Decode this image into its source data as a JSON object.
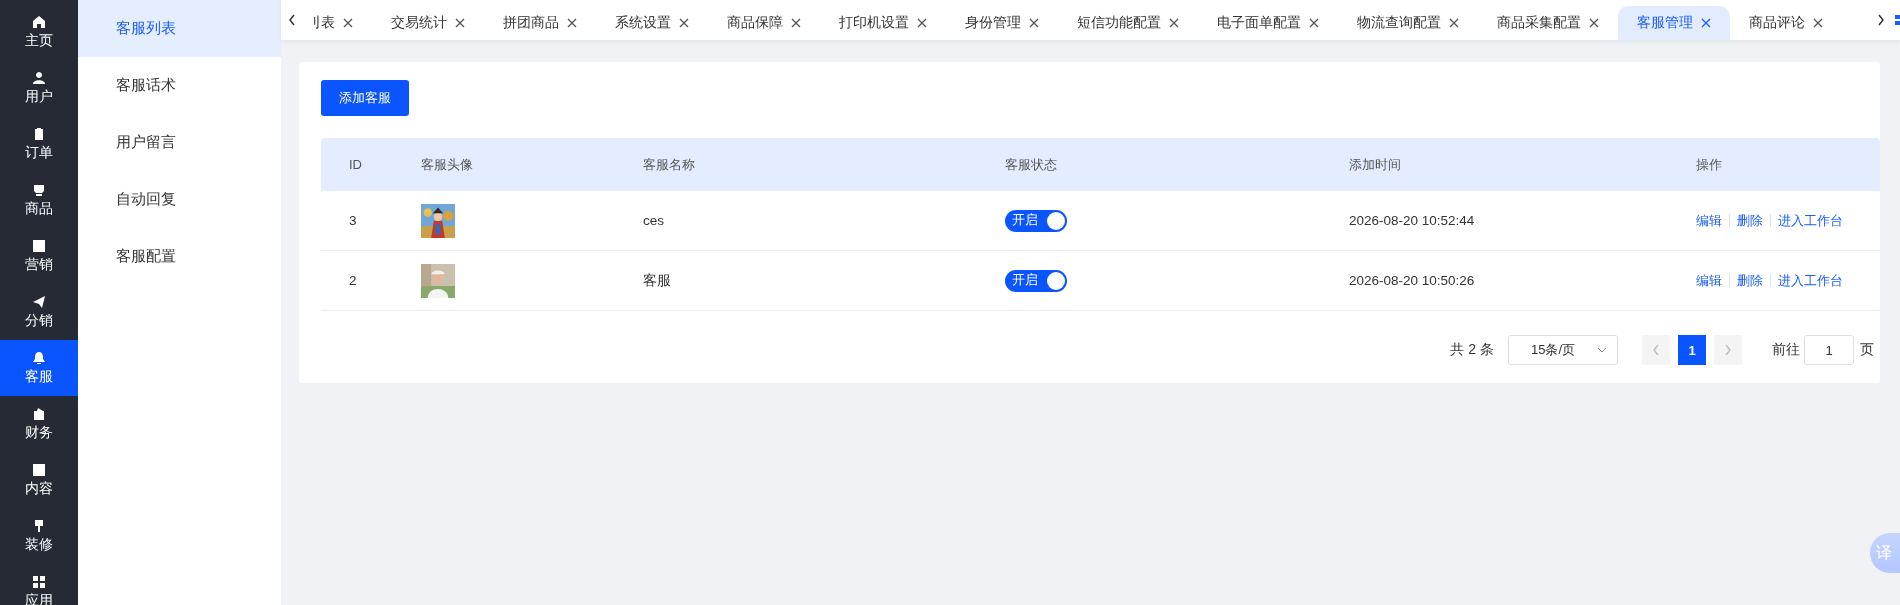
{
  "nav": [
    {
      "label": "主页",
      "selected": false
    },
    {
      "label": "用户",
      "selected": false
    },
    {
      "label": "订单",
      "selected": false
    },
    {
      "label": "商品",
      "selected": false
    },
    {
      "label": "营销",
      "selected": false
    },
    {
      "label": "分销",
      "selected": false
    },
    {
      "label": "客服",
      "selected": true
    },
    {
      "label": "财务",
      "selected": false
    },
    {
      "label": "内容",
      "selected": false
    },
    {
      "label": "装修",
      "selected": false
    },
    {
      "label": "应用",
      "selected": false
    }
  ],
  "subnav": [
    {
      "label": "客服列表",
      "selected": true
    },
    {
      "label": "客服话术",
      "selected": false
    },
    {
      "label": "用户留言",
      "selected": false
    },
    {
      "label": "自动回复",
      "selected": false
    },
    {
      "label": "客服配置",
      "selected": false
    }
  ],
  "tabs": [
    {
      "label": "刂表",
      "selected": false
    },
    {
      "label": "交易统计",
      "selected": false
    },
    {
      "label": "拼团商品",
      "selected": false
    },
    {
      "label": "系统设置",
      "selected": false
    },
    {
      "label": "商品保障",
      "selected": false
    },
    {
      "label": "打印机设置",
      "selected": false
    },
    {
      "label": "身份管理",
      "selected": false
    },
    {
      "label": "短信功能配置",
      "selected": false
    },
    {
      "label": "电子面单配置",
      "selected": false
    },
    {
      "label": "物流查询配置",
      "selected": false
    },
    {
      "label": "商品采集配置",
      "selected": false
    },
    {
      "label": "客服管理",
      "selected": true
    },
    {
      "label": "商品评论",
      "selected": false
    }
  ],
  "add_button": "添加客服",
  "table": {
    "columns": [
      "ID",
      "客服头像",
      "客服名称",
      "客服状态",
      "添加时间",
      "操作"
    ],
    "rows": [
      {
        "id": "3",
        "name": "ces",
        "status": {
          "label": "开启",
          "on": true
        },
        "time": "2026-08-20 10:52:44",
        "actions": [
          "编辑",
          "删除",
          "进入工作台"
        ]
      },
      {
        "id": "2",
        "name": "客服",
        "status": {
          "label": "开启",
          "on": true
        },
        "time": "2026-08-20 10:50:26",
        "actions": [
          "编辑",
          "删除",
          "进入工作台"
        ]
      }
    ]
  },
  "pagination": {
    "total": "共 2 条",
    "page_size": "15条/页",
    "prev": {
      "disabled": true
    },
    "pages": [
      {
        "label": "1",
        "selected": true
      }
    ],
    "next": {
      "disabled": true
    },
    "goto_label": "前往",
    "goto_value": "1",
    "page_suffix": "页"
  },
  "translate_button": "译"
}
